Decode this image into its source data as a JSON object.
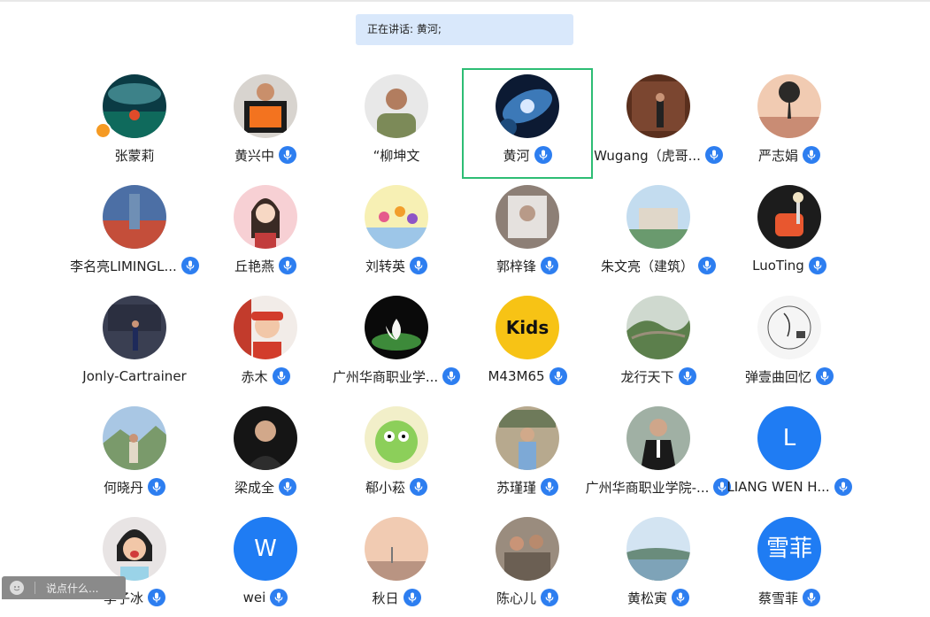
{
  "speaking": "正在讲话: 黄河;",
  "chat": {
    "placeholder": "说点什么..."
  },
  "participants": [
    {
      "name": "张蒙莉",
      "avatar": "sea-island-icon",
      "mic": false,
      "host": true
    },
    {
      "name": "黄兴中",
      "avatar": "child-photo-icon",
      "mic": true
    },
    {
      "name": "“柳坤文",
      "avatar": "man-portrait-icon",
      "mic": false
    },
    {
      "name": "黄河",
      "avatar": "galaxy-icon",
      "mic": true,
      "active": true
    },
    {
      "name": "Wugang（虎哥...",
      "avatar": "library-photo-icon",
      "mic": true
    },
    {
      "name": "严志娟",
      "avatar": "sunset-tree-icon",
      "mic": true
    },
    {
      "name": "李名亮LIMINGL...",
      "avatar": "fountain-photo-icon",
      "mic": true
    },
    {
      "name": "丘艳燕",
      "avatar": "girl-cartoon-icon",
      "mic": true
    },
    {
      "name": "刘转英",
      "avatar": "flower-cartoon-icon",
      "mic": true
    },
    {
      "name": "郭梓锋",
      "avatar": "frame-photo-icon",
      "mic": true
    },
    {
      "name": "朱文亮（建筑）",
      "avatar": "building-photo-icon",
      "mic": true
    },
    {
      "name": "LuoTing",
      "avatar": "chair-lamp-icon",
      "mic": true
    },
    {
      "name": "Jonly-Cartrainer",
      "avatar": "stage-speaker-icon",
      "mic": false
    },
    {
      "name": "赤木",
      "avatar": "boy-photo-icon",
      "mic": true
    },
    {
      "name": "广州华商职业学...",
      "avatar": "lotus-icon",
      "mic": true
    },
    {
      "name": "M43M65",
      "avatar": "kids-logo-icon",
      "mic": true,
      "text": "Kids"
    },
    {
      "name": "龙行天下",
      "avatar": "great-wall-icon",
      "mic": true
    },
    {
      "name": "弹壹曲回忆",
      "avatar": "ink-drawing-icon",
      "mic": true
    },
    {
      "name": "何晓丹",
      "avatar": "mountain-woman-icon",
      "mic": true
    },
    {
      "name": "梁成全",
      "avatar": "man-black-icon",
      "mic": true
    },
    {
      "name": "郗小菘",
      "avatar": "frog-cartoon-icon",
      "mic": true
    },
    {
      "name": "苏瑾瑾",
      "avatar": "bookstore-woman-icon",
      "mic": true
    },
    {
      "name": "广州华商职业学院-...",
      "avatar": "suit-man-icon",
      "mic": true
    },
    {
      "name": "LIANG WEN H...",
      "avatar": "letter-avatar-icon",
      "mic": true,
      "text": "L"
    },
    {
      "name": "李子冰",
      "avatar": "girl-photo-icon",
      "mic": true
    },
    {
      "name": "wei",
      "avatar": "letter-avatar-icon",
      "mic": true,
      "text": "W"
    },
    {
      "name": "秋日",
      "avatar": "dusk-sky-icon",
      "mic": true
    },
    {
      "name": "陈心儿",
      "avatar": "group-photo-icon",
      "mic": true
    },
    {
      "name": "黄松寅",
      "avatar": "lake-photo-icon",
      "mic": true
    },
    {
      "name": "蔡雪菲",
      "avatar": "letter-avatar-icon",
      "mic": true,
      "text": "雪菲"
    }
  ],
  "colors": {
    "mic": "#2d7ef0",
    "active_border": "#2dbd74",
    "speaking_bg": "#d9e8fb",
    "letter_avatar": "#1f7cf3"
  }
}
